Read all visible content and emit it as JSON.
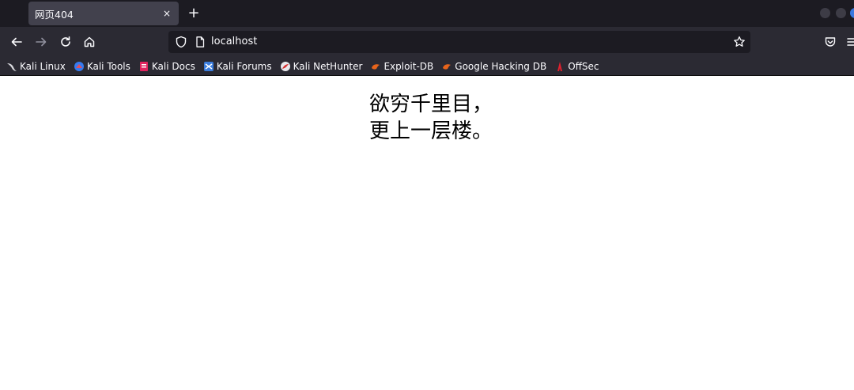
{
  "tab": {
    "title": "网页404",
    "close_glyph": "×"
  },
  "newtab_glyph": "+",
  "urlbar": {
    "url": "localhost"
  },
  "bookmarks": [
    {
      "label": "Kali Linux",
      "icon": "kali-dragon-icon"
    },
    {
      "label": "Kali Tools",
      "icon": "kali-tools-icon"
    },
    {
      "label": "Kali Docs",
      "icon": "kali-docs-icon"
    },
    {
      "label": "Kali Forums",
      "icon": "kali-forums-icon"
    },
    {
      "label": "Kali NetHunter",
      "icon": "nethunter-icon"
    },
    {
      "label": "Exploit-DB",
      "icon": "exploit-db-icon"
    },
    {
      "label": "Google Hacking DB",
      "icon": "ghdb-icon"
    },
    {
      "label": "OffSec",
      "icon": "offsec-icon"
    }
  ],
  "page": {
    "line1": "欲穷千里目，",
    "line2": "更上一层楼。"
  },
  "colors": {
    "titlebar": "#1c1b22",
    "toolbar": "#2b2a33",
    "tab_active": "#42414d",
    "text": "#fbfbfe"
  }
}
